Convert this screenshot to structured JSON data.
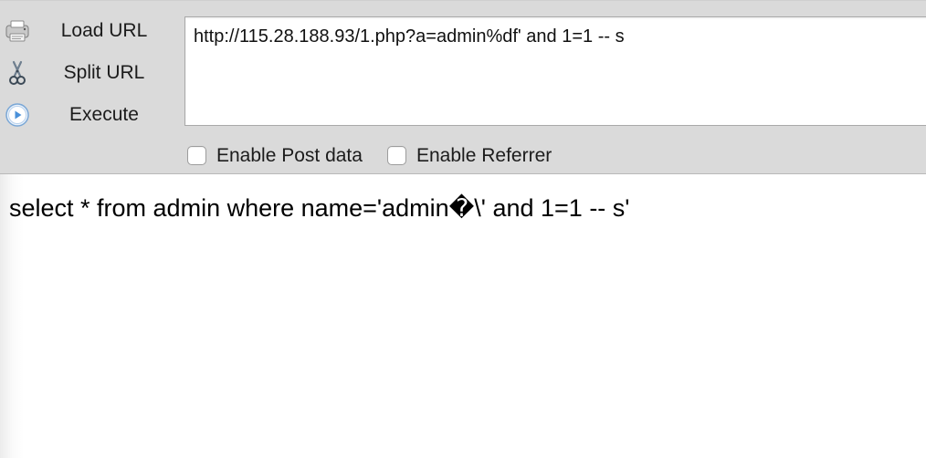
{
  "toolbar": {
    "actions": [
      {
        "label": "Load URL",
        "icon": "load-url-icon"
      },
      {
        "label": "Split URL",
        "icon": "scissors-icon"
      },
      {
        "label": "Execute",
        "icon": "play-icon"
      }
    ],
    "url": "http://115.28.188.93/1.php?a=admin%df' and 1=1 -- s",
    "options": [
      {
        "label": "Enable Post data",
        "checked": false
      },
      {
        "label": "Enable Referrer",
        "checked": false
      }
    ]
  },
  "page": {
    "output": "select * from admin where name='admin�\\' and 1=1 -- s'"
  },
  "colors": {
    "toolbar_bg": "#dadada",
    "play_icon": "#4a90d9"
  }
}
